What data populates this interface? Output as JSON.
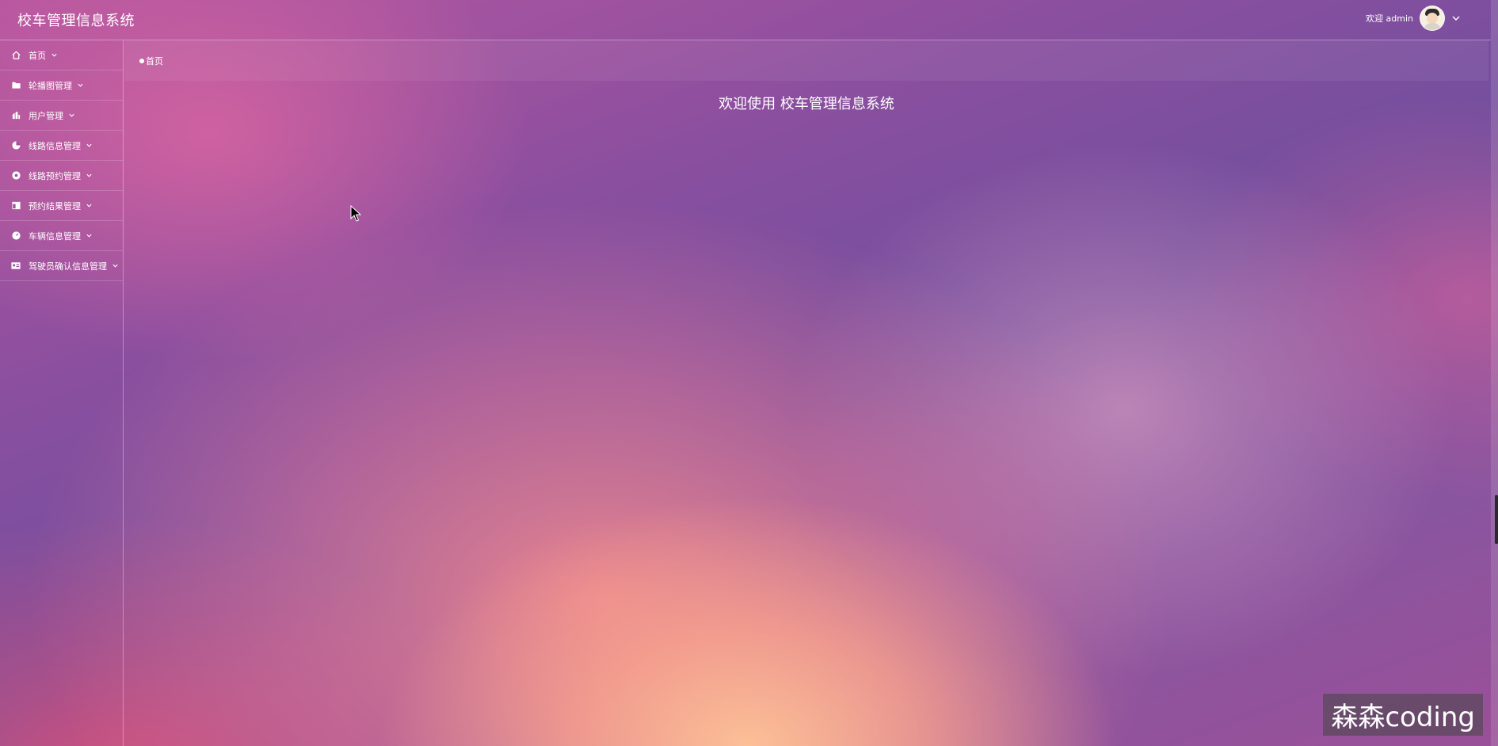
{
  "header": {
    "app_title": "校车管理信息系统",
    "welcome_prefix": "欢迎",
    "username": "admin"
  },
  "sidebar": {
    "items": [
      {
        "label": "首页",
        "icon": "home-icon"
      },
      {
        "label": "轮播图管理",
        "icon": "folder-icon"
      },
      {
        "label": "用户管理",
        "icon": "user-group-icon"
      },
      {
        "label": "线路信息管理",
        "icon": "pie-chart-icon"
      },
      {
        "label": "线路预约管理",
        "icon": "record-icon"
      },
      {
        "label": "预约结果管理",
        "icon": "table-icon"
      },
      {
        "label": "车辆信息管理",
        "icon": "gauge-icon"
      },
      {
        "label": "驾驶员确认信息管理",
        "icon": "id-card-icon"
      }
    ]
  },
  "breadcrumb": {
    "current": "首页"
  },
  "main": {
    "welcome_heading": "欢迎使用 校车管理信息系统"
  },
  "watermark": {
    "text": "森森coding"
  }
}
